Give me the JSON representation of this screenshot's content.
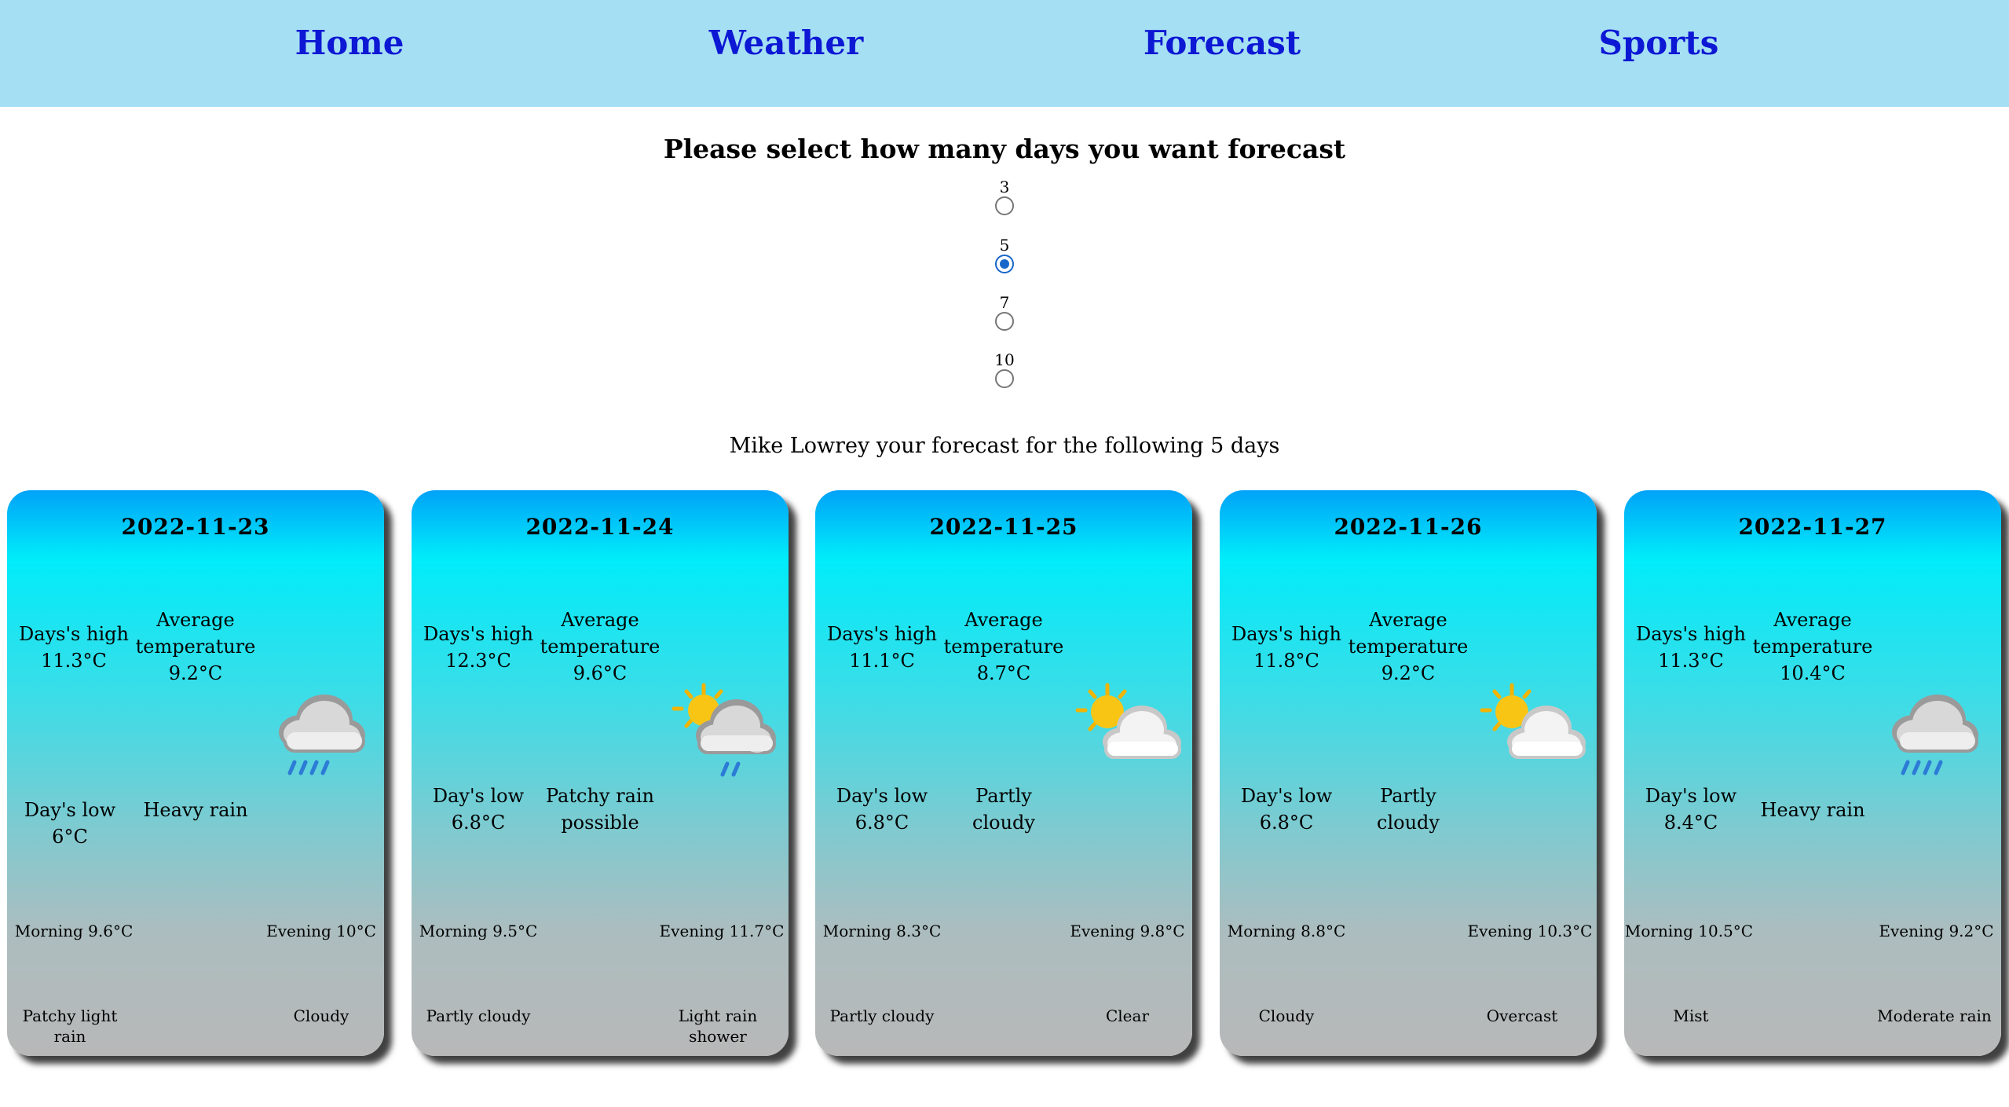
{
  "nav": {
    "links": [
      "Home",
      "Weather",
      "Forecast",
      "Sports"
    ]
  },
  "prompt": "Please select how many days you want forecast",
  "day_options": [
    {
      "label": "3",
      "checked": false
    },
    {
      "label": "5",
      "checked": true
    },
    {
      "label": "7",
      "checked": false
    },
    {
      "label": "10",
      "checked": false
    }
  ],
  "subtitle": "Mike Lowrey your forecast for the following 5 days",
  "cards": [
    {
      "date": "2022-11-23",
      "high_label": "Days's high",
      "high": "11.3°C",
      "avg_label": "Average temperature",
      "avg": "9.2°C",
      "low_text": "Day's low 6°C",
      "condition": "Heavy rain",
      "icon": "heavy-rain-icon",
      "morning": "Morning 9.6°C",
      "evening": "Evening 10°C",
      "morning_condition": "Patchy light rain",
      "evening_condition": "Cloudy"
    },
    {
      "date": "2022-11-24",
      "high_label": "Days's high",
      "high": "12.3°C",
      "avg_label": "Average temperature",
      "avg": "9.6°C",
      "low_label": "Day's low",
      "low": "6.8°C",
      "condition": "Patchy rain possible",
      "icon": "sun-cloud-rain-icon",
      "morning": "Morning 9.5°C",
      "evening": "Evening 11.7°C",
      "morning_condition": "Partly cloudy",
      "evening_condition": "Light rain shower"
    },
    {
      "date": "2022-11-25",
      "high_label": "Days's high",
      "high": "11.1°C",
      "avg_label": "Average temperature",
      "avg": "8.7°C",
      "low_label": "Day's low",
      "low": "6.8°C",
      "condition": "Partly cloudy",
      "icon": "partly-cloudy-icon",
      "morning": "Morning 8.3°C",
      "evening": "Evening 9.8°C",
      "morning_condition": "Partly cloudy",
      "evening_condition": "Clear"
    },
    {
      "date": "2022-11-26",
      "high_label": "Days's high",
      "high": "11.8°C",
      "avg_label": "Average temperature",
      "avg": "9.2°C",
      "low_label": "Day's low",
      "low": "6.8°C",
      "condition": "Partly cloudy",
      "icon": "partly-cloudy-icon",
      "morning": "Morning 8.8°C",
      "evening": "Evening 10.3°C",
      "morning_condition": "Cloudy",
      "evening_condition": "Overcast"
    },
    {
      "date": "2022-11-27",
      "high_label": "Days's high",
      "high": "11.3°C",
      "avg_label": "Average temperature",
      "avg": "10.4°C",
      "low_label": "Day's low",
      "low": "8.4°C",
      "condition": "Heavy rain",
      "icon": "heavy-rain-icon",
      "morning": "Morning 10.5°C",
      "evening": "Evening 9.2°C",
      "morning_condition": "Mist",
      "evening_condition": "Moderate rain"
    }
  ],
  "colors": {
    "nav_bg": "#a5dff3",
    "nav_link": "#0d18d4",
    "radio_checked": "#1866c9"
  }
}
